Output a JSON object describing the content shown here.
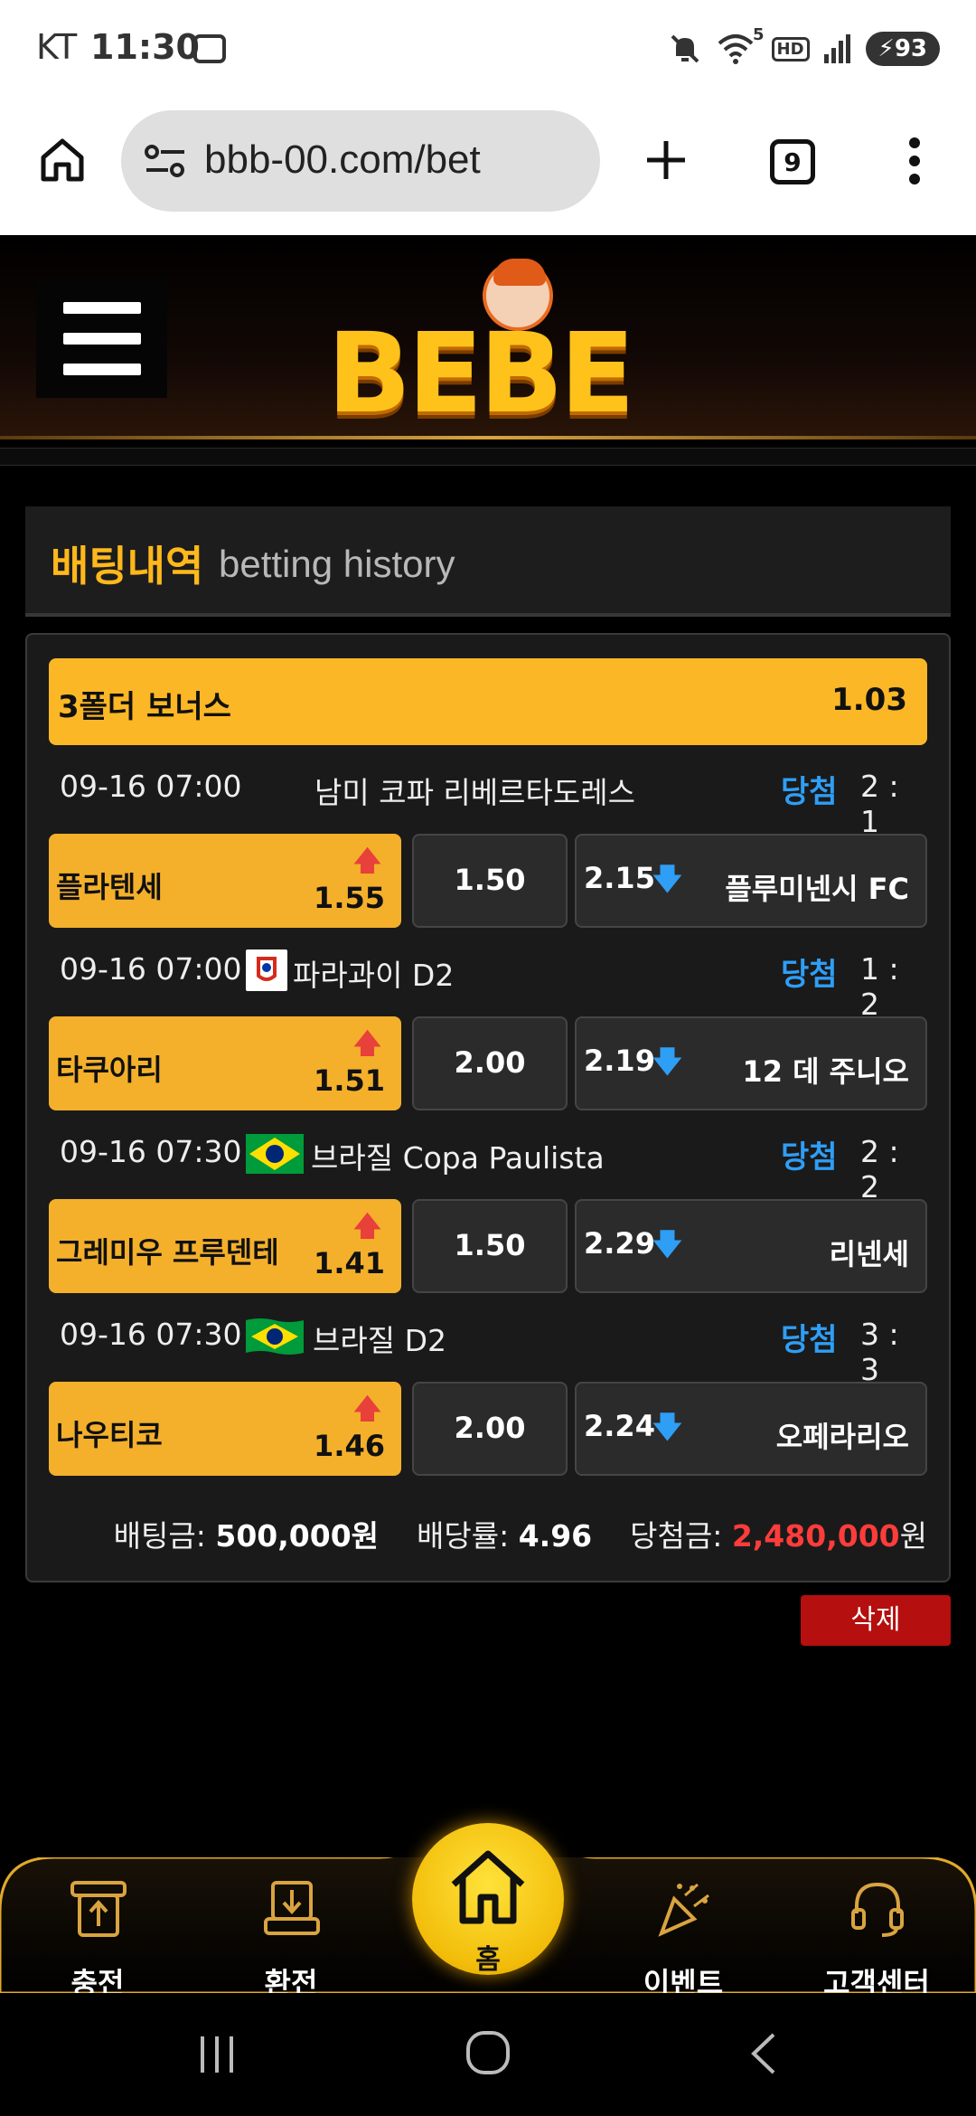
{
  "status_bar": {
    "carrier": "KT",
    "time": "11:30",
    "network_badge": "5",
    "hd_badge": "HD",
    "battery": "93",
    "icons": [
      "screenshot-icon",
      "mute-icon",
      "wifi-icon",
      "signal-icon",
      "battery-icon"
    ]
  },
  "browser": {
    "url": "bbb-00.com/bet",
    "tab_count": "9",
    "icons": [
      "home-icon",
      "site-info-icon",
      "new-tab-icon",
      "more-icon"
    ]
  },
  "header": {
    "logo_text": "BEBE"
  },
  "section": {
    "title_ko": "배팅내역",
    "title_en": "betting history"
  },
  "bet": {
    "bonus_label": "3폴더 보너스",
    "bonus_odds": "1.03",
    "matches": [
      {
        "datetime": "09-16 07:00",
        "league": "남미 코파 리베르타도레스",
        "flag": "none",
        "status": "당첨",
        "score": "2 : 1",
        "home": "플라텐세",
        "home_odds": "1.55",
        "draw_odds": "1.50",
        "away_odds": "2.15",
        "away": "플루미넨시 FC"
      },
      {
        "datetime": "09-16 07:00",
        "league": "파라과이 D2",
        "flag": "paraguay-league-icon",
        "status": "당첨",
        "score": "1 : 2",
        "home": "타쿠아리",
        "home_odds": "1.51",
        "draw_odds": "2.00",
        "away_odds": "2.19",
        "away": "12 데 주니오"
      },
      {
        "datetime": "09-16 07:30",
        "league": "브라질 Copa Paulista",
        "flag": "brazil-flag-icon",
        "status": "당첨",
        "score": "2 : 2",
        "home": "그레미우 프루덴테",
        "home_odds": "1.41",
        "draw_odds": "1.50",
        "away_odds": "2.29",
        "away": "리넨세"
      },
      {
        "datetime": "09-16 07:30",
        "league": "브라질 D2",
        "flag": "brazil-flag-icon",
        "status": "당첨",
        "score": "3 : 3",
        "home": "나우티코",
        "home_odds": "1.46",
        "draw_odds": "2.00",
        "away_odds": "2.24",
        "away": "오페라리오"
      }
    ],
    "summary": {
      "stake_label": "배팅금:",
      "stake_value": "500,000원",
      "rate_label": "배당률:",
      "rate_value": "4.96",
      "win_label": "당첨금:",
      "win_value": "2,480,000",
      "win_unit": "원"
    },
    "delete_label": "삭제"
  },
  "bottom_nav": [
    {
      "label": "충전",
      "icon": "deposit-icon"
    },
    {
      "label": "환전",
      "icon": "withdraw-icon"
    },
    {
      "label": "홈",
      "icon": "home-icon"
    },
    {
      "label": "이벤트",
      "icon": "event-icon"
    },
    {
      "label": "고객센터",
      "icon": "headset-icon"
    }
  ],
  "colors": {
    "accent": "#fbb726",
    "win_status": "#2f9ef5",
    "odds_up": "#e8403a",
    "delete": "#b50f0f"
  }
}
